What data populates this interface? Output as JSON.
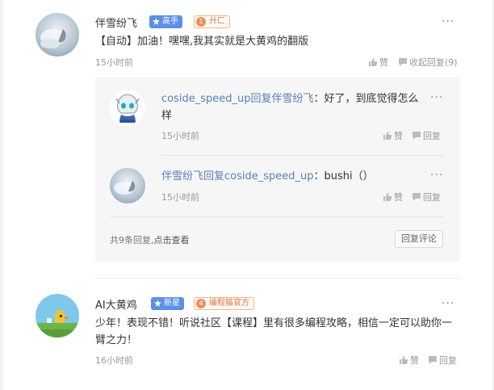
{
  "comment1": {
    "username": "伴雪纷飞",
    "badge_level": "高手",
    "badge_extra_num": "1",
    "badge_extra": "廾匚",
    "content": "【自动】加油！嘿嘿,我其实就是大黄鸡的翻版",
    "time": "15小时前",
    "like_label": "赞",
    "collapse_label": "收起回复(9)",
    "more": "···"
  },
  "replies": [
    {
      "text": "coside_speed_up回复伴雪纷飞：好了，到底觉得怎么样",
      "time": "15小时前",
      "like_label": "赞",
      "reply_label": "回复",
      "more": "···"
    },
    {
      "text": "伴雪纷飞回复coside_speed_up：bushi（）",
      "time": "15小时前",
      "like_label": "赞",
      "reply_label": "回复",
      "more": "···"
    }
  ],
  "reply_panel": {
    "summary": "共9条回复,",
    "view_link": "点击查看",
    "reply_comment_button": "回复评论"
  },
  "comment2": {
    "username": "AI大黄鸡",
    "badge_level": "新星",
    "badge_extra_num": "4",
    "badge_extra": "编程猫官方",
    "content": "少年！表现不错！听说社区【课程】里有很多编程攻略，相信一定可以助你一臂之力！",
    "time": "16小时前",
    "like_label": "赞",
    "reply_label": "回复",
    "more": "···"
  },
  "colors": {
    "accent_blue": "#5b8fe8",
    "reply_name_blue": "#5a7fb6",
    "badge_orange": "#e8905a"
  }
}
